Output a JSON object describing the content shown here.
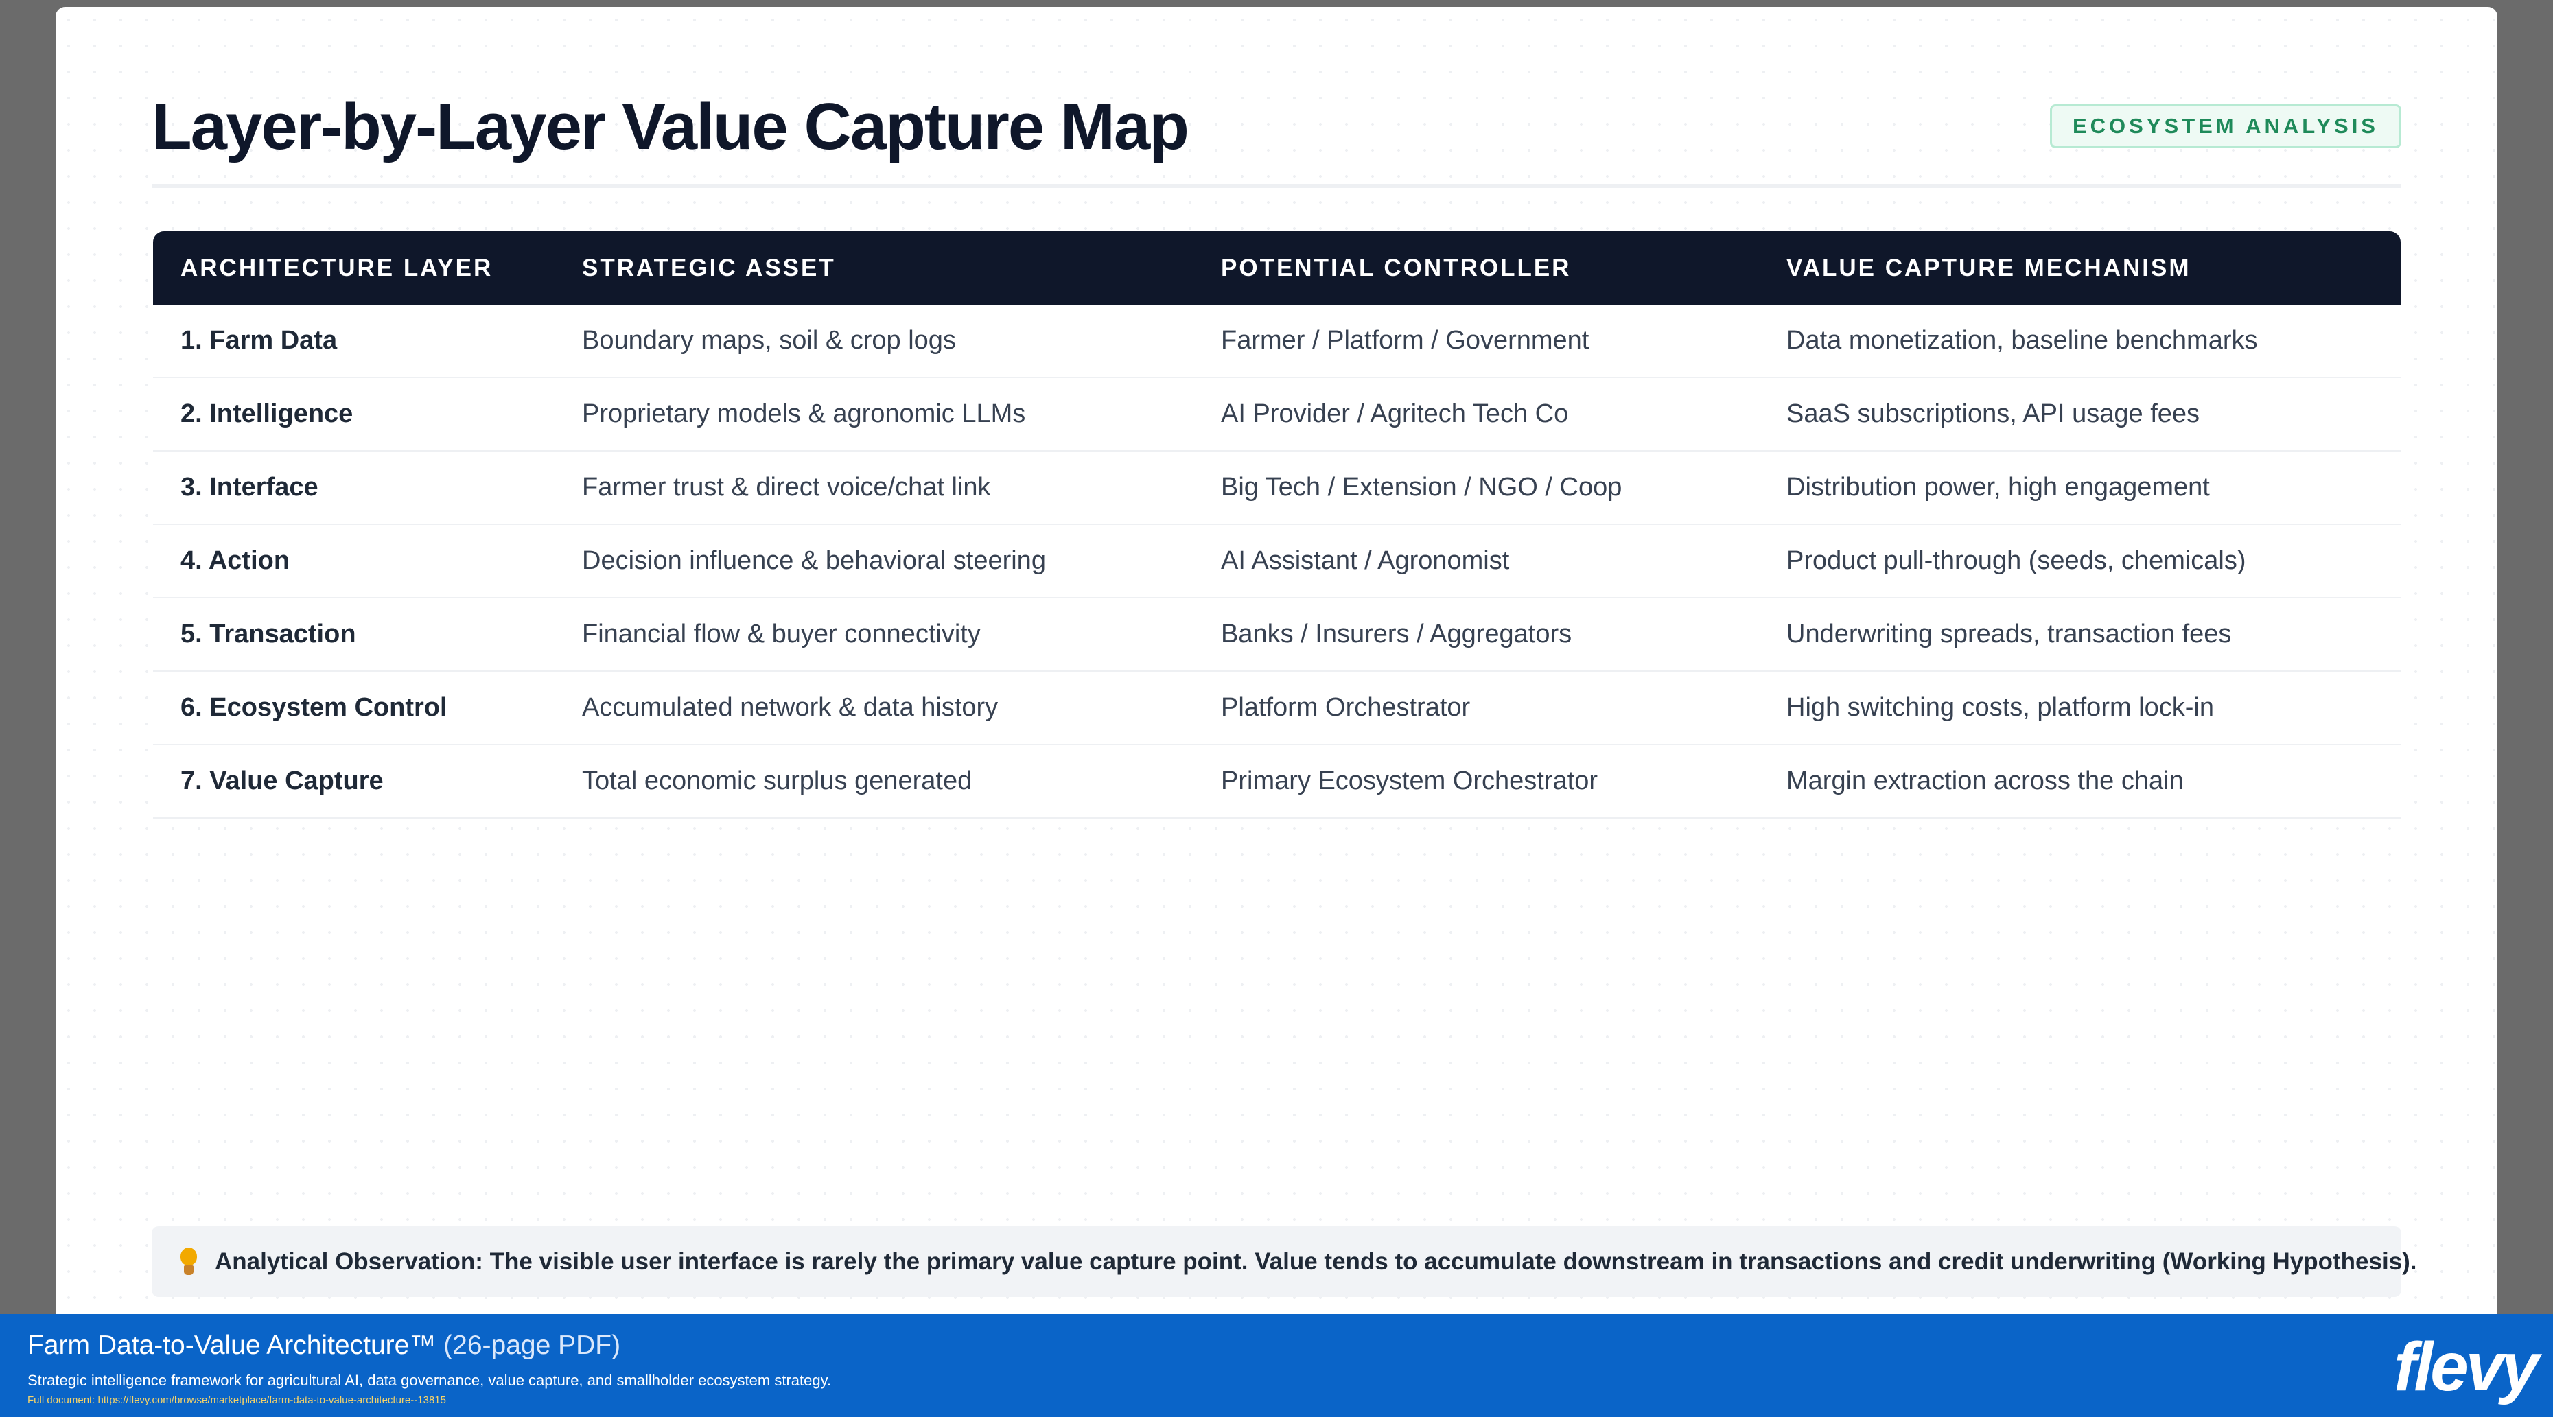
{
  "title": "Layer-by-Layer Value Capture Map",
  "badge": "ECOSYSTEM ANALYSIS",
  "table": {
    "headers": [
      "ARCHITECTURE LAYER",
      "STRATEGIC ASSET",
      "POTENTIAL CONTROLLER",
      "VALUE CAPTURE MECHANISM"
    ],
    "rows": [
      [
        "1. Farm Data",
        "Boundary maps, soil & crop logs",
        "Farmer / Platform / Government",
        "Data monetization, baseline benchmarks"
      ],
      [
        "2. Intelligence",
        "Proprietary models & agronomic LLMs",
        "AI Provider / Agritech Tech Co",
        "SaaS subscriptions, API usage fees"
      ],
      [
        "3. Interface",
        "Farmer trust & direct voice/chat link",
        "Big Tech / Extension / NGO / Coop",
        "Distribution power, high engagement"
      ],
      [
        "4. Action",
        "Decision influence & behavioral steering",
        "AI Assistant / Agronomist",
        "Product pull-through (seeds, chemicals)"
      ],
      [
        "5. Transaction",
        "Financial flow & buyer connectivity",
        "Banks / Insurers / Aggregators",
        "Underwriting spreads, transaction fees"
      ],
      [
        "6. Ecosystem Control",
        "Accumulated network & data history",
        "Platform Orchestrator",
        "High switching costs, platform lock-in"
      ],
      [
        "7. Value Capture",
        "Total economic surplus generated",
        "Primary Ecosystem Orchestrator",
        "Margin extraction across the chain"
      ]
    ]
  },
  "observation": {
    "icon": "lightbulb-icon",
    "text": "Analytical Observation: The visible user interface is rarely the primary value capture point. Value tends to accumulate downstream in transactions and credit underwriting (Working Hypothesis)."
  },
  "footer": {
    "title": "Farm Data-to-Value Architecture™",
    "pages": "(26-page PDF)",
    "subtitle": "Strategic intelligence framework for agricultural AI, data governance, value capture, and smallholder ecosystem strategy.",
    "url": "Full document: https://flevy.com/browse/marketplace/farm-data-to-value-architecture--13815",
    "logo": "flevy"
  },
  "colors": {
    "header_bg": "#0f172a",
    "badge_text": "#1f8a5a",
    "footer_bg": "#0a64c8",
    "accent_url": "#f5d36a"
  }
}
